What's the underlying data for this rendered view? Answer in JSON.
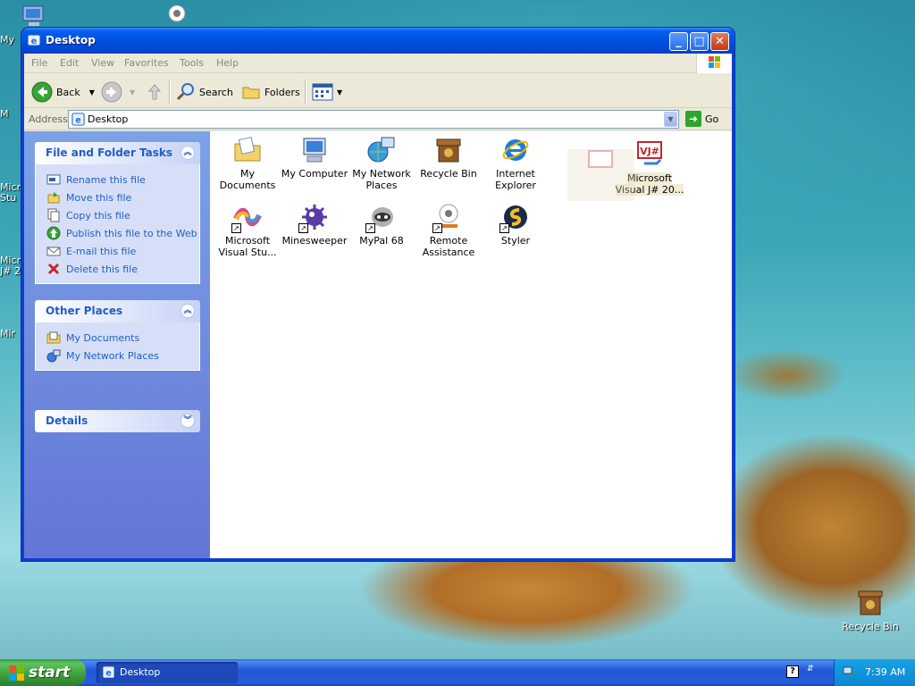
{
  "desktop": {
    "left_labels": [
      "My",
      "M",
      "Micro\nStu",
      "Micro\nJ# 2",
      "Mir"
    ],
    "recycle_bin_label": "Recycle Bin"
  },
  "window": {
    "title": "Desktop",
    "menu": [
      "File",
      "Edit",
      "View",
      "Favorites",
      "Tools",
      "Help"
    ],
    "toolbar": {
      "back": "Back",
      "search": "Search",
      "folders": "Folders"
    },
    "address": {
      "label": "Address",
      "value": "Desktop",
      "go": "Go"
    }
  },
  "taskpane": {
    "file_tasks": {
      "title": "File and Folder Tasks",
      "items": [
        "Rename this file",
        "Move this file",
        "Copy this file",
        "Publish this file to the Web",
        "E-mail this file",
        "Delete this file"
      ]
    },
    "other_places": {
      "title": "Other Places",
      "items": [
        "My Documents",
        "My Network Places"
      ]
    },
    "details": {
      "title": "Details"
    }
  },
  "files": [
    {
      "label": "My Documents"
    },
    {
      "label": "My Computer"
    },
    {
      "label": "My Network Places"
    },
    {
      "label": "Recycle Bin"
    },
    {
      "label": "Internet Explorer"
    },
    {
      "label": "Microsoft Visual J# 20..."
    },
    {
      "label": "Microsoft Visual Stu..."
    },
    {
      "label": "Minesweeper"
    },
    {
      "label": "MyPal 68"
    },
    {
      "label": "Remote Assistance"
    },
    {
      "label": "Styler"
    }
  ],
  "taskbar": {
    "start": "start",
    "task_label": "Desktop",
    "clock": "7:39 AM"
  }
}
